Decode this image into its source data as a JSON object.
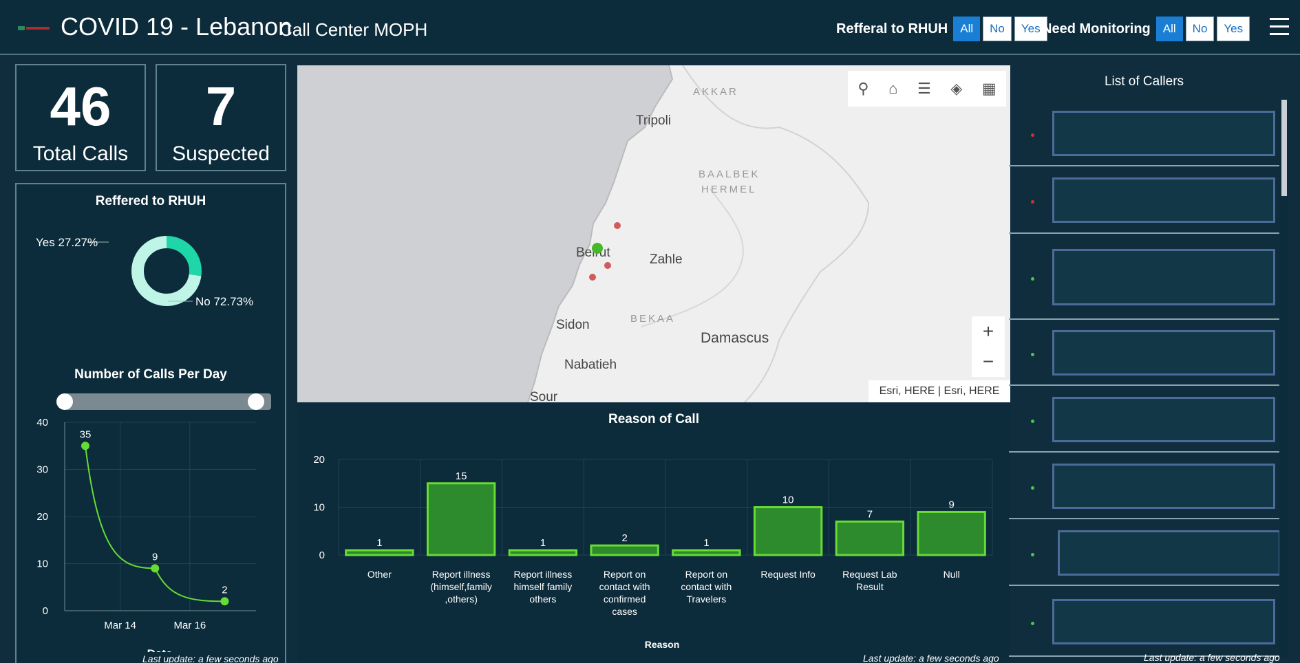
{
  "header": {
    "title_main": "COVID 19 - Lebanon",
    "title_sub": "Call Center MOPH",
    "filter_referral_label": "Refferal to RHUH",
    "filter_monitoring_label": "Need Monitoring",
    "filter_options": [
      "All",
      "No",
      "Yes"
    ]
  },
  "kpis": {
    "total_calls": {
      "value": "46",
      "label": "Total Calls"
    },
    "suspected": {
      "value": "7",
      "label": "Suspected"
    }
  },
  "referred_panel": {
    "title": "Reffered to RHUH",
    "yes_label": "Yes 27.27%",
    "no_label": "No 72.73%"
  },
  "calls_per_day_panel": {
    "title": "Number of Calls Per Day",
    "footer": "Last update: a few seconds ago"
  },
  "map": {
    "attribution": "Esri, HERE | Esri, HERE",
    "cities": [
      "Tripoli",
      "Beirut",
      "Zahle",
      "Sidon",
      "Damascus",
      "Nabatieh",
      "Sour"
    ],
    "regions": [
      "AKKAR",
      "BAALBEK",
      "HERMEL",
      "BEKAA"
    ],
    "zoom_in": "+",
    "zoom_out": "−"
  },
  "reason_panel": {
    "title": "Reason of Call",
    "footer": "Last update: a few seconds ago"
  },
  "callers_panel": {
    "title": "List of Callers",
    "footer": "Last update: a few seconds ago",
    "status_colors": [
      "#cc3333",
      "#cc3333",
      "#44cc44",
      "#44cc44",
      "#44cc44",
      "#44cc44",
      "#44cc44",
      "#44cc44"
    ]
  },
  "colors": {
    "background": "#0c2b3b",
    "accent": "#1a7fd4",
    "bar_fill": "#2d8a2d",
    "bar_stroke": "#66dd33",
    "line": "#66dd33",
    "donut_yes": "#1fd6a8",
    "donut_no": "#bff5e6"
  },
  "chart_data": [
    {
      "type": "pie",
      "title": "Reffered to RHUH",
      "categories": [
        "Yes",
        "No"
      ],
      "values": [
        27.27,
        72.73
      ],
      "data_labels": [
        "Yes 27.27%",
        "No 72.73%"
      ],
      "donut": true
    },
    {
      "type": "line",
      "title": "Number of Calls Per Day",
      "xlabel": "Date",
      "ylabel": "",
      "x": [
        "Mar 13",
        "Mar 15",
        "Mar 17"
      ],
      "x_tick_labels": [
        "Mar 14",
        "Mar 16"
      ],
      "values": [
        35,
        9,
        2
      ],
      "data_labels": [
        "35",
        "9",
        "2"
      ],
      "y_ticks": [
        "0",
        "10",
        "20",
        "30",
        "40"
      ],
      "ylim": [
        0,
        40
      ],
      "grid": true
    },
    {
      "type": "bar",
      "title": "Reason of Call",
      "xlabel": "Reason",
      "ylabel": "",
      "categories": [
        [
          "Other"
        ],
        [
          "Report illness",
          "(himself,family",
          ",others)"
        ],
        [
          "Report illness",
          "himself family",
          "others"
        ],
        [
          "Report on",
          "contact with",
          "confirmed",
          "cases"
        ],
        [
          "Report on",
          "contact with",
          "Travelers"
        ],
        [
          "Request Info"
        ],
        [
          "Request Lab",
          "Result"
        ],
        [
          "Null"
        ]
      ],
      "values": [
        1,
        15,
        1,
        2,
        1,
        10,
        7,
        9
      ],
      "data_labels": [
        "1",
        "15",
        "1",
        "2",
        "1",
        "10",
        "7",
        "9"
      ],
      "y_ticks": [
        "0",
        "10",
        "20"
      ],
      "ylim": [
        0,
        20
      ],
      "grid": true
    }
  ]
}
